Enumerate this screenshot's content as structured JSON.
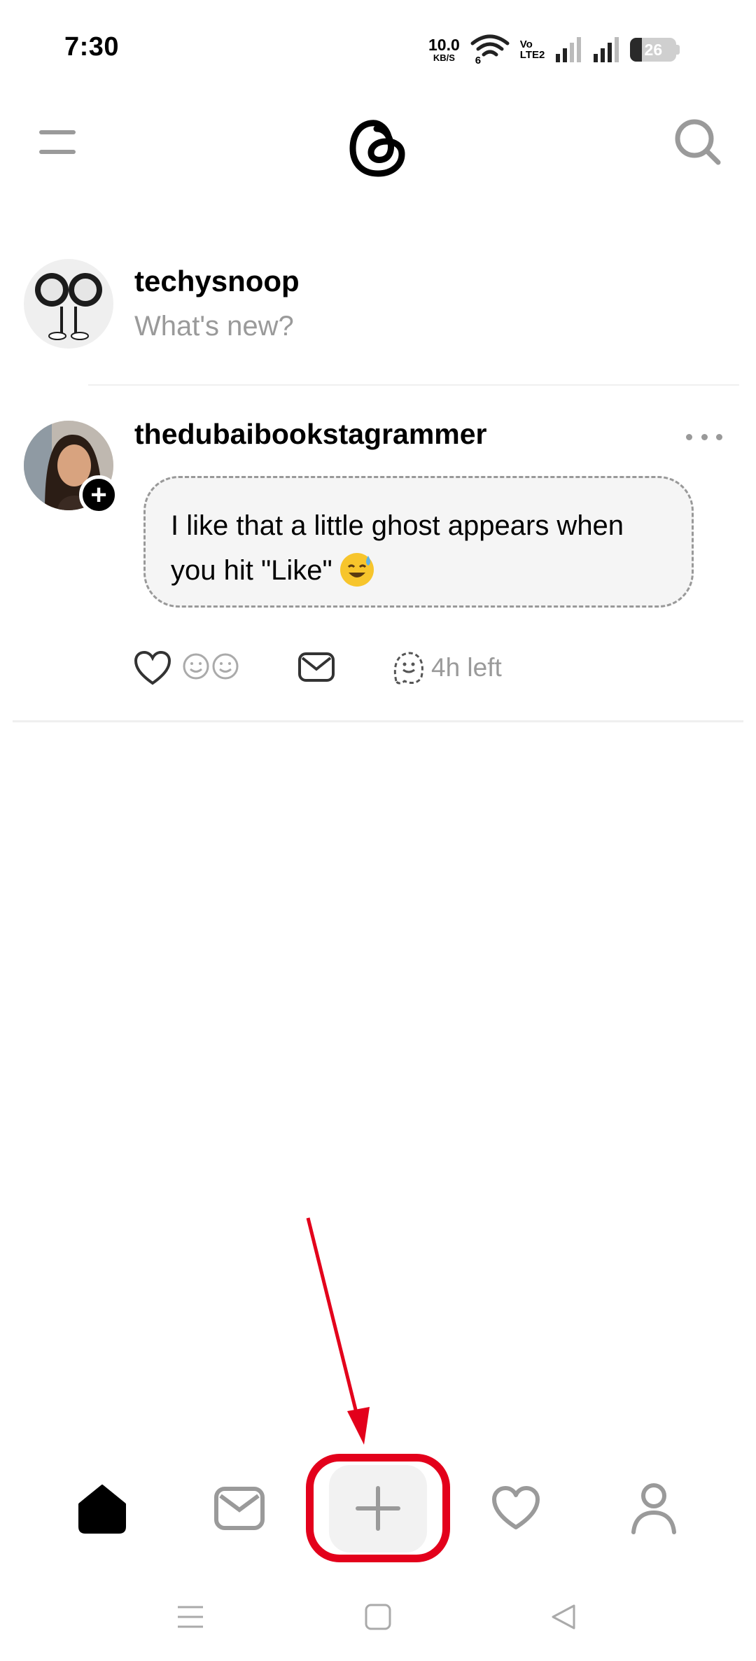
{
  "status_bar": {
    "time": "7:30",
    "net_speed_value": "10.0",
    "net_speed_unit": "KB/S",
    "wifi_label": "6",
    "volte_top": "Vo",
    "volte_bottom": "LTE2",
    "battery_level": "26"
  },
  "header": {
    "menu_icon": "menu-icon",
    "logo_icon": "threads-logo-icon",
    "search_icon": "search-icon"
  },
  "composer": {
    "username": "techysnoop",
    "placeholder": "What's new?"
  },
  "post": {
    "author": "thedubaibookstagrammer",
    "text": "I like that a little ghost appears when you hit \"Like\"",
    "emoji": "sweat-smile-emoji",
    "time_left": "4h left"
  },
  "bottom_nav": {
    "items": [
      "home-icon",
      "inbox-icon",
      "compose-icon",
      "activity-icon",
      "profile-icon"
    ],
    "active": "home-icon"
  },
  "annotation": {
    "color": "#e3001b"
  }
}
